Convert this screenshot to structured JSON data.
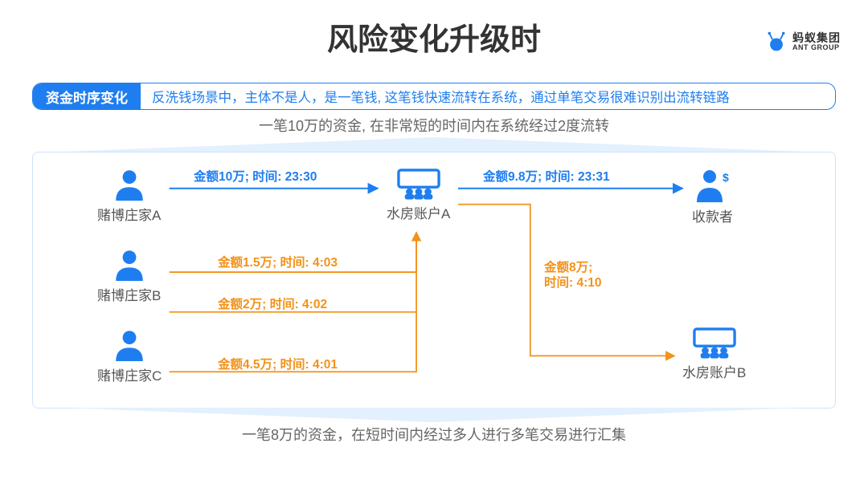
{
  "title": "风险变化升级时",
  "logo": {
    "cn": "蚂蚁集团",
    "en": "ANT GROUP"
  },
  "banner": {
    "tag": "资金时序变化",
    "body": "反洗钱场景中，主体不是人，是一笔钱, 这笔钱快速流转在系统，通过单笔交易很难识别出流转链路"
  },
  "caption_top": "一笔10万的资金, 在非常短的时间内在系统经过2度流转",
  "caption_bottom": "一笔8万的资金，在短时间内经过多人进行多笔交易进行汇集",
  "nodes": {
    "a": "赌博庄家A",
    "b": "赌博庄家B",
    "c": "赌博庄家C",
    "wa": "水房账户A",
    "wb": "水房账户B",
    "rec": "收款者"
  },
  "edges": {
    "e1": "金额10万; 时间: 23:30",
    "e2": "金额9.8万; 时间: 23:31",
    "e3": "金额1.5万; 时间: 4:03",
    "e4": "金额2万; 时间: 4:02",
    "e5": "金额4.5万; 时间: 4:01",
    "e6a": "金额8万;",
    "e6b": "时间: 4:10"
  },
  "chart_data": {
    "type": "flow-diagram",
    "title": "风险变化升级时 — 资金时序变化",
    "nodes": [
      {
        "id": "A",
        "label": "赌博庄家A",
        "role": "gambler"
      },
      {
        "id": "B",
        "label": "赌博庄家B",
        "role": "gambler"
      },
      {
        "id": "C",
        "label": "赌博庄家C",
        "role": "gambler"
      },
      {
        "id": "WA",
        "label": "水房账户A",
        "role": "money-house"
      },
      {
        "id": "WB",
        "label": "水房账户B",
        "role": "money-house"
      },
      {
        "id": "R",
        "label": "收款者",
        "role": "payee"
      }
    ],
    "edges": [
      {
        "from": "A",
        "to": "WA",
        "amount_wan": 10,
        "time": "23:30",
        "group": "flow1"
      },
      {
        "from": "WA",
        "to": "R",
        "amount_wan": 9.8,
        "time": "23:31",
        "group": "flow1"
      },
      {
        "from": "A",
        "to": "WA",
        "amount_wan": 1.5,
        "time": "4:03",
        "group": "flow2"
      },
      {
        "from": "B",
        "to": "WA",
        "amount_wan": 2,
        "time": "4:02",
        "group": "flow2"
      },
      {
        "from": "C",
        "to": "WA",
        "amount_wan": 4.5,
        "time": "4:01",
        "group": "flow2"
      },
      {
        "from": "WA",
        "to": "WB",
        "amount_wan": 8,
        "time": "4:10",
        "group": "flow2"
      }
    ],
    "annotations": {
      "flow1": "一笔10万的资金, 在非常短的时间内在系统经过2度流转",
      "flow2": "一笔8万的资金，在短时间内经过多人进行多笔交易进行汇集"
    }
  }
}
